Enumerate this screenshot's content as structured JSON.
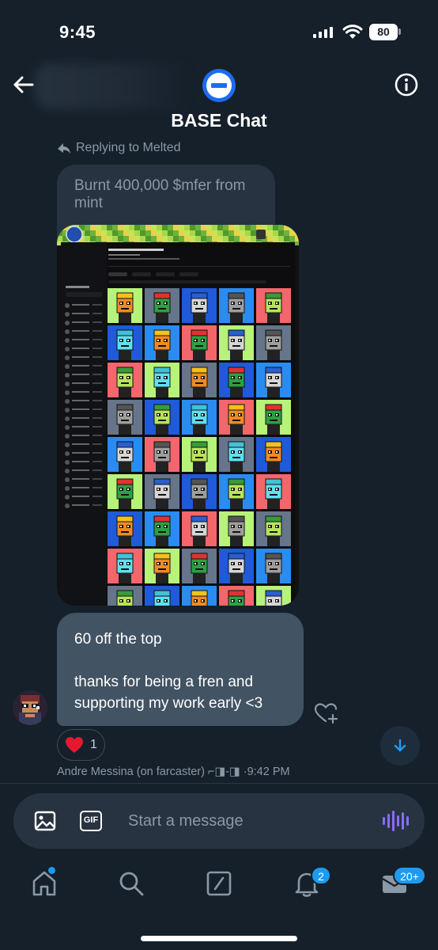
{
  "status_bar": {
    "time": "9:45",
    "battery": "80"
  },
  "header": {
    "title": "BASE Chat"
  },
  "reply": {
    "label": "Replying to Melted",
    "quoted_text": "Burnt 400,000 $mfer from mint"
  },
  "message": {
    "line1": "60 off the top",
    "line2": "thanks for being a fren and supporting my work early <3",
    "reaction_emoji": "❤️",
    "reaction_count": "1",
    "sender": "Andre Messina (on farcaster) ⌐◨-◨",
    "separator": "·",
    "time": "9:42 PM"
  },
  "composer": {
    "placeholder": "Start a message",
    "gif_label": "GIF"
  },
  "tab_bar": {
    "notifications_badge": "2",
    "messages_badge": "20+"
  },
  "colors": {
    "background": "#15202b",
    "accent": "#1d9bf0",
    "bubble": "#425363",
    "quoted_bubble": "#273340",
    "voice": "#8b6cf6"
  },
  "icons": [
    "back-arrow-icon",
    "info-icon",
    "reply-arrow-icon",
    "image-icon",
    "gif-icon",
    "voice-icon",
    "home-icon",
    "search-icon",
    "compose-icon",
    "bell-icon",
    "mail-icon",
    "heart-plus-icon",
    "arrow-down-icon"
  ]
}
